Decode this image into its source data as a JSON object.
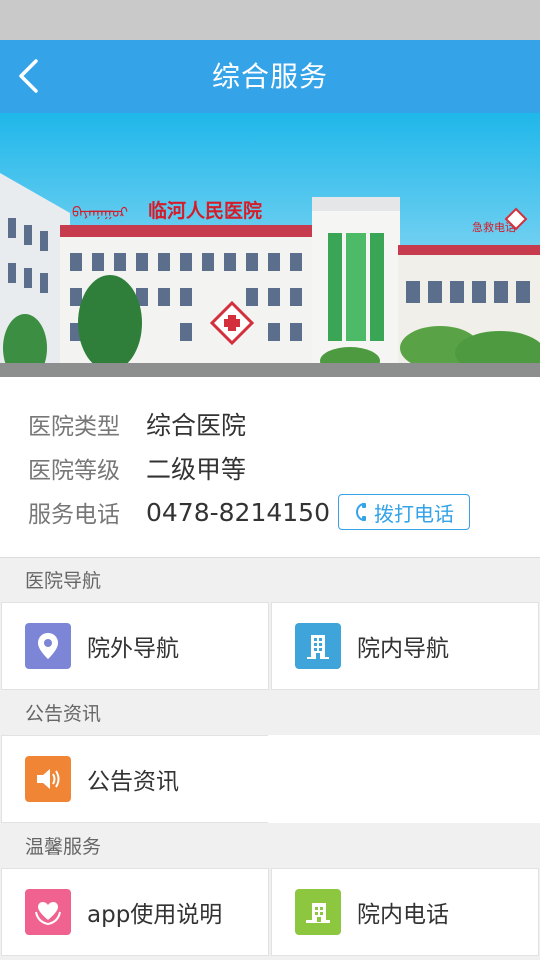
{
  "header": {
    "title": "综合服务"
  },
  "hero": {
    "hospital_sign": "临河人民医院",
    "mongolian_sign": "ᠪᠠᠶᠠᠨᠨᠠᠭᠤᠷ",
    "emergency_sign": "急救电话"
  },
  "info": {
    "type_label": "医院类型",
    "type_value": "综合医院",
    "level_label": "医院等级",
    "level_value": "二级甲等",
    "phone_label": "服务电话",
    "phone_value": "0478-8214150",
    "call_button": "拨打电话"
  },
  "sections": {
    "navigation": {
      "title": "医院导航",
      "outside": "院外导航",
      "inside": "院内导航"
    },
    "notice": {
      "title": "公告资讯",
      "notice": "公告资讯"
    },
    "care": {
      "title": "温馨服务",
      "app_guide": "app使用说明",
      "phone": "院内电话"
    }
  },
  "colors": {
    "primary": "#35a3e8",
    "icon_outside_nav": "#7d86d6",
    "icon_inside_nav": "#3fa4d9",
    "icon_notice": "#f08536",
    "icon_app_guide": "#f06391",
    "icon_phone": "#8dc63f"
  },
  "icons": {
    "back": "chevron-left-icon",
    "call": "phone-icon",
    "outside_nav": "location-pin-icon",
    "inside_nav": "building-icon",
    "notice": "speaker-icon",
    "app_guide": "heart-hands-icon",
    "phone": "hospital-building-icon"
  }
}
